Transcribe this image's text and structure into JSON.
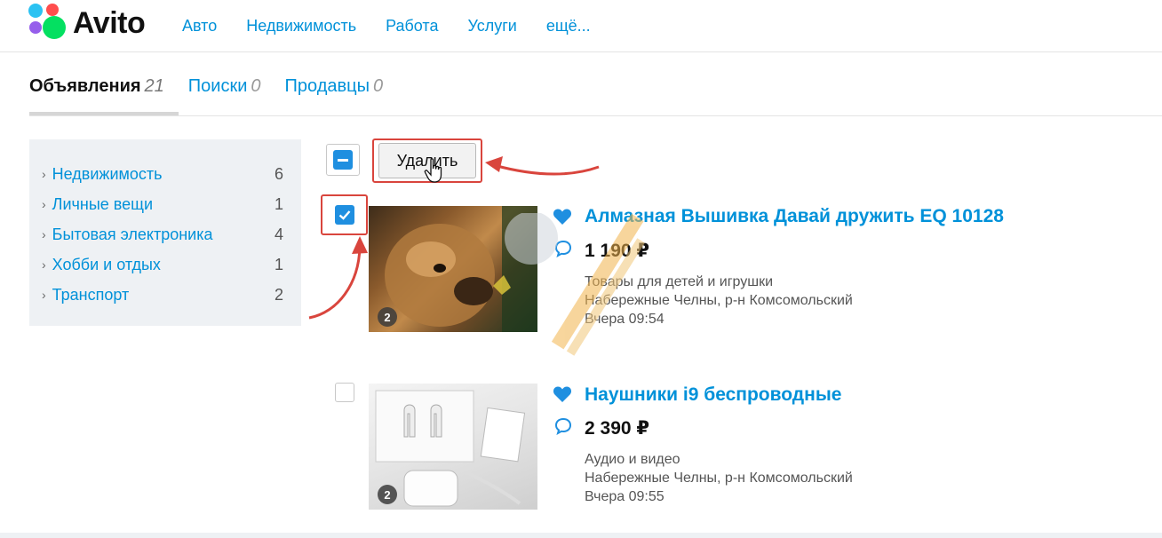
{
  "header": {
    "logo_text": "Avito",
    "nav": [
      "Авто",
      "Недвижимость",
      "Работа",
      "Услуги",
      "ещё..."
    ]
  },
  "tabs": [
    {
      "label": "Объявления",
      "count": "21",
      "active": true
    },
    {
      "label": "Поиски",
      "count": "0",
      "active": false
    },
    {
      "label": "Продавцы",
      "count": "0",
      "active": false
    }
  ],
  "sidebar": {
    "items": [
      {
        "label": "Недвижимость",
        "count": "6"
      },
      {
        "label": "Личные вещи",
        "count": "1"
      },
      {
        "label": "Бытовая электроника",
        "count": "4"
      },
      {
        "label": "Хобби и отдых",
        "count": "1"
      },
      {
        "label": "Транспорт",
        "count": "2"
      }
    ]
  },
  "toolbar": {
    "delete_label": "Удалить"
  },
  "listings": [
    {
      "title": "Алмазная Вышивка Давай дружить EQ 10128",
      "price": "1 190 ₽",
      "category": "Товары для детей и игрушки",
      "location": "Набережные Челны, р-н Комсомольский",
      "date": "Вчера 09:54",
      "photo_count": "2",
      "checked": true
    },
    {
      "title": "Наушники i9 беспроводные",
      "price": "2 390 ₽",
      "category": "Аудио и видео",
      "location": "Набережные Челны, р-н Комсомольский",
      "date": "Вчера 09:55",
      "photo_count": "2",
      "checked": false
    }
  ],
  "colors": {
    "link": "#0091d9",
    "checkbox": "#1f8fe0",
    "annotation_red": "#d9453d",
    "sidebar_bg": "#eef1f4"
  },
  "icons": [
    "heart-icon",
    "message-icon",
    "check-icon",
    "minus-icon",
    "chevron-right-icon",
    "hand-cursor-icon"
  ]
}
